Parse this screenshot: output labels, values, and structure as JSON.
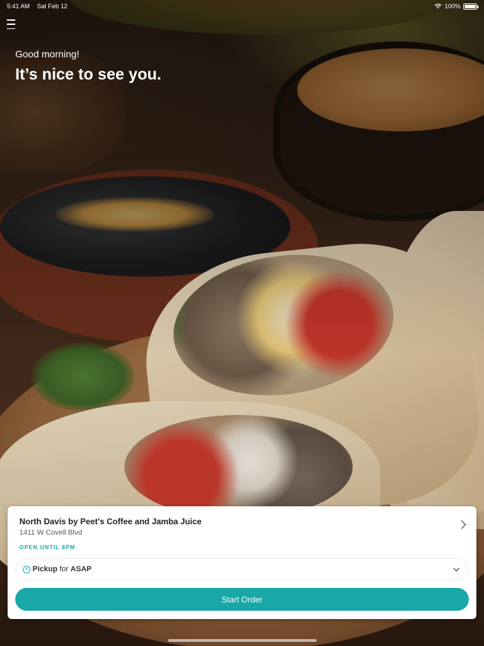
{
  "status_bar": {
    "time": "5:41 AM",
    "date": "Sat Feb 12",
    "battery": "100%"
  },
  "header": {
    "menu_icon": "hamburger-menu-icon",
    "greeting": "Good morning!",
    "headline": "It’s nice to see you."
  },
  "order_card": {
    "store_name": "North Davis by Peet's Coffee and Jamba Juice",
    "store_address": "1411 W Covell Blvd",
    "open_status": "OPEN UNTIL 8PM",
    "pickup": {
      "mode": "Pickup",
      "connector": "for",
      "time": "ASAP"
    },
    "start_button_label": "Start Order"
  },
  "colors": {
    "accent": "#19a7a7",
    "card_background": "#ffffff"
  }
}
